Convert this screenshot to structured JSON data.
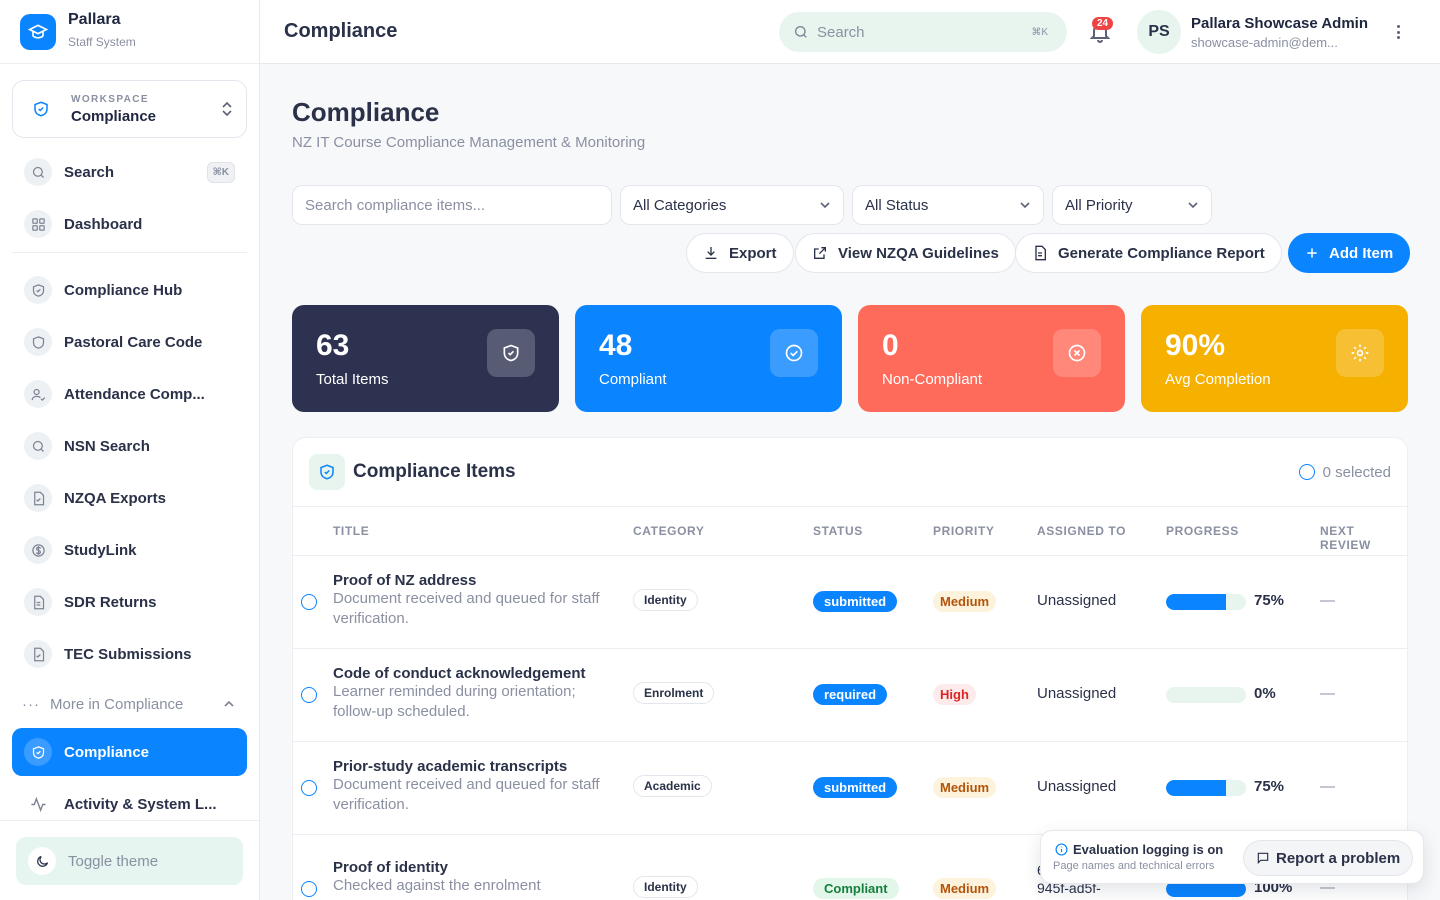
{
  "brand": {
    "name": "Pallara",
    "subtitle": "Staff System"
  },
  "workspace": {
    "label": "WORKSPACE",
    "value": "Compliance"
  },
  "sidebar": {
    "search_label": "Search",
    "search_shortcut": "⌘K",
    "dashboard": "Dashboard",
    "items": [
      {
        "label": "Compliance Hub",
        "icon": "shield-icon"
      },
      {
        "label": "Pastoral Care Code",
        "icon": "shield-icon"
      },
      {
        "label": "Attendance Comp...",
        "icon": "user-check-icon"
      },
      {
        "label": "NSN Search",
        "icon": "search-icon"
      },
      {
        "label": "NZQA Exports",
        "icon": "file-check-icon"
      },
      {
        "label": "StudyLink",
        "icon": "dollar-icon"
      },
      {
        "label": "SDR Returns",
        "icon": "document-icon"
      },
      {
        "label": "TEC Submissions",
        "icon": "file-check-icon"
      }
    ],
    "more": "More in Compliance",
    "active": "Compliance",
    "activity": "Activity & System L...",
    "toggle_theme": "Toggle theme"
  },
  "header": {
    "title": "Compliance",
    "search_placeholder": "Search",
    "search_shortcut": "⌘K",
    "notifications": "24",
    "avatar_initials": "PS",
    "user_name": "Pallara Showcase Admin",
    "user_email": "showcase-admin@dem..."
  },
  "page": {
    "title": "Compliance",
    "subtitle": "NZ IT Course Compliance Management & Monitoring"
  },
  "filters": {
    "search_placeholder": "Search compliance items...",
    "category": "All Categories",
    "status": "All Status",
    "priority": "All Priority"
  },
  "actions": {
    "export": "Export",
    "guidelines": "View NZQA Guidelines",
    "report": "Generate Compliance Report",
    "add": "Add Item"
  },
  "stats": [
    {
      "value": "63",
      "label": "Total Items",
      "color": "#2d3250"
    },
    {
      "value": "48",
      "label": "Compliant",
      "color": "#0a84ff"
    },
    {
      "value": "0",
      "label": "Non-Compliant",
      "color": "#ff6b5b"
    },
    {
      "value": "90%",
      "label": "Avg Completion",
      "color": "#f5b000"
    }
  ],
  "table": {
    "title": "Compliance Items",
    "selected": "0 selected",
    "columns": [
      "TITLE",
      "CATEGORY",
      "STATUS",
      "PRIORITY",
      "ASSIGNED TO",
      "PROGRESS",
      "NEXT REVIEW"
    ],
    "rows": [
      {
        "title": "Proof of NZ address",
        "desc": "Document received and queued for staff verification.",
        "category": "Identity",
        "status": "submitted",
        "priority": "Medium",
        "assigned": "Unassigned",
        "progress": 75,
        "progress_label": "75%",
        "review": "—"
      },
      {
        "title": "Code of conduct acknowledgement",
        "desc": "Learner reminded during orientation; follow-up scheduled.",
        "category": "Enrolment",
        "status": "required",
        "priority": "High",
        "assigned": "Unassigned",
        "progress": 0,
        "progress_label": "0%",
        "review": "—"
      },
      {
        "title": "Prior-study academic transcripts",
        "desc": "Document received and queued for staff verification.",
        "category": "Academic",
        "status": "submitted",
        "priority": "Medium",
        "assigned": "Unassigned",
        "progress": 75,
        "progress_label": "75%",
        "review": "—"
      },
      {
        "title": "Proof of identity",
        "desc": "Checked against the enrolment",
        "category": "Identity",
        "status": "Compliant",
        "priority": "Medium",
        "assigned": "6... 4e7a-945f-ad5f-",
        "progress": 100,
        "progress_label": "100%",
        "review": "—"
      }
    ]
  },
  "colors": {
    "accent": "#0a84ff",
    "status_submitted": "#0a84ff",
    "status_required": "#0a84ff",
    "status_compliant": "#e3f6ea",
    "priority_medium": "#fdf3dc",
    "priority_high": "#fdeaea"
  },
  "toast": {
    "title": "Evaluation logging is on",
    "subtitle": "Page names and technical errors",
    "report": "Report a problem"
  }
}
